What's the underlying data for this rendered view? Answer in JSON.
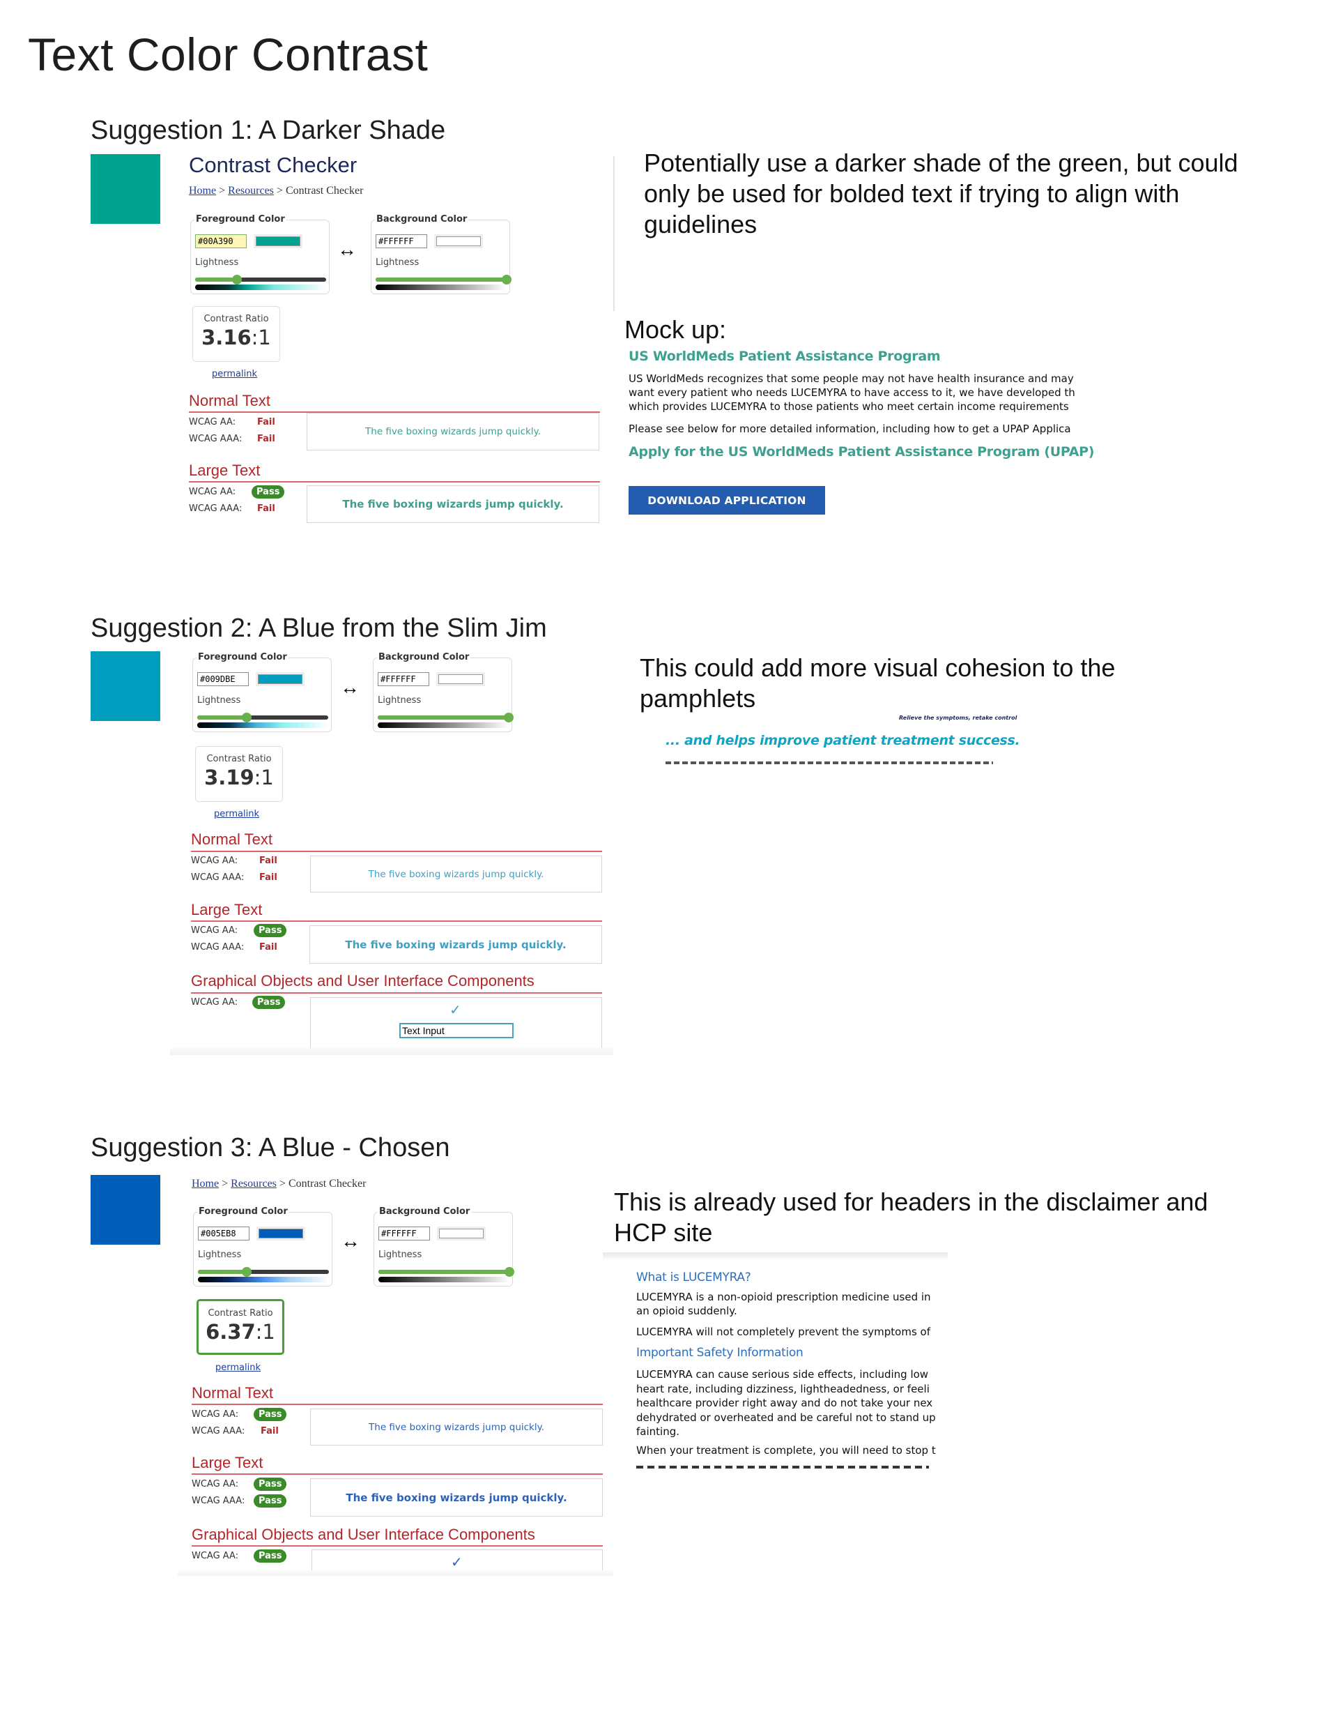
{
  "page": {
    "title": "Text Color Contrast"
  },
  "common": {
    "foreground_legend": "Foreground Color",
    "background_legend": "Background Color",
    "lightness_label": "Lightness",
    "contrast_ratio_label": "Contrast Ratio",
    "ratio_suffix": ":1",
    "permalink": "permalink",
    "normal_text_heading": "Normal Text",
    "large_text_heading": "Large Text",
    "graphical_heading": "Graphical Objects and User Interface Components",
    "wcag_aa": "WCAG AA:",
    "wcag_aaa": "WCAG AAA:",
    "sample_text": "The five boxing wizards jump quickly.",
    "swap_icon": "↔",
    "check_icon": "✓",
    "text_input_value": "Text Input",
    "background_hex": "#FFFFFF",
    "background_lightness": 1.0
  },
  "suggestions": [
    {
      "title": "Suggestion 1: A Darker Shade",
      "swatch_color": "#00A390",
      "checker": {
        "heading": "Contrast Checker",
        "breadcrumb": {
          "home": "Home",
          "sep": ">",
          "resources": "Resources",
          "current": "Contrast Checker"
        },
        "foreground_hex": "#00A390",
        "foreground_lightness": 0.32,
        "ratio": "3.16",
        "normal": {
          "aa": "Fail",
          "aaa": "Fail"
        },
        "large": {
          "aa": "Pass",
          "aaa": "Fail"
        }
      },
      "note": "Potentially use a darker shade of the green, but could only be used for bolded text if trying to align with guidelines",
      "mockup": {
        "label": "Mock up:",
        "heading": "US WorldMeds Patient Assistance Program",
        "paragraph_lines": [
          "US WorldMeds recognizes that some people may not have health insurance and may",
          "want every patient who needs LUCEMYRA to have access to it, we have developed th",
          "which provides LUCEMYRA to those patients who meet certain income requirements"
        ],
        "paragraph2": "Please see below for more detailed information, including how to get a UPAP Applica",
        "subheading": "Apply for the US WorldMeds Patient Assistance Program (UPAP)",
        "button": "DOWNLOAD APPLICATION",
        "heading_color": "#3fa08f",
        "button_color": "#245db0"
      }
    },
    {
      "title": "Suggestion 2: A Blue from the Slim Jim",
      "swatch_color": "#009DBE",
      "checker": {
        "foreground_hex": "#009DBE",
        "foreground_lightness": 0.38,
        "ratio": "3.19",
        "normal": {
          "aa": "Fail",
          "aaa": "Fail"
        },
        "large": {
          "aa": "Pass",
          "aaa": "Fail"
        },
        "graphical": {
          "aa": "Pass"
        }
      },
      "note": "This could add more visual cohesion to the pamphlets",
      "mockup": {
        "tagline": "Relieve the symptoms, retake control",
        "headline": "... and helps improve patient treatment success.",
        "headline_color": "#11a3c2"
      }
    },
    {
      "title": "Suggestion 3: A Blue - Chosen",
      "swatch_color": "#005EB8",
      "checker": {
        "breadcrumb": {
          "home": "Home",
          "sep": ">",
          "resources": "Resources",
          "current": "Contrast Checker"
        },
        "foreground_hex": "#005EB8",
        "foreground_lightness": 0.37,
        "ratio": "6.37",
        "normal": {
          "aa": "Pass",
          "aaa": "Fail"
        },
        "large": {
          "aa": "Pass",
          "aaa": "Pass"
        },
        "graphical": {
          "aa": "Pass"
        }
      },
      "note": "This is already used for headers in the disclaimer and HCP site",
      "mockup": {
        "heading1": "What is LUCEMYRA?",
        "p1_lines": [
          "LUCEMYRA is a non-opioid prescription medicine used in",
          "an opioid suddenly."
        ],
        "p2": "LUCEMYRA will not completely prevent the symptoms of",
        "heading2": "Important Safety Information",
        "p3_lines": [
          "LUCEMYRA can cause serious side effects, including low",
          "heart rate, including dizziness, lightheadedness, or feeli",
          "healthcare provider right away and do not take your nex",
          "dehydrated or overheated and be careful not to stand up",
          "fainting."
        ],
        "p4": "When your treatment is complete, you will need to stop t",
        "heading_color": "#2e6fba"
      }
    }
  ]
}
